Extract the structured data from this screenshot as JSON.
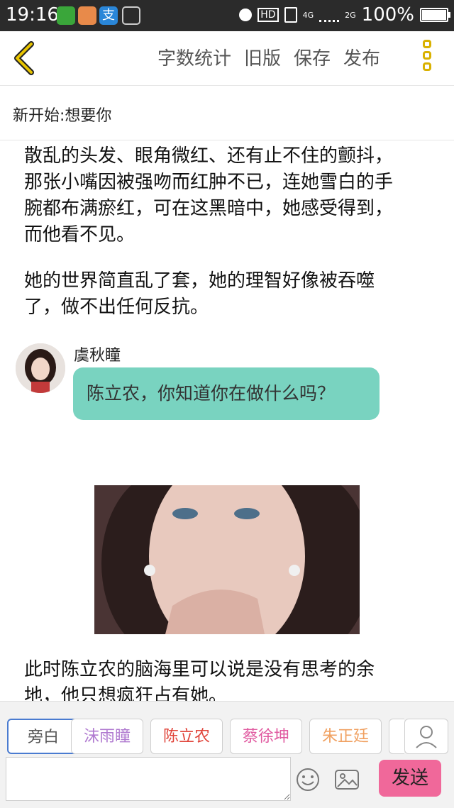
{
  "status_bar": {
    "time": "19:16",
    "network_top": "4G",
    "network_bottom": "2G",
    "hd": "HD",
    "battery": "100%",
    "battery_level": 1.0
  },
  "toolbar": {
    "word_count": "字数统计",
    "old_version": "旧版",
    "save": "保存",
    "publish": "发布"
  },
  "story_title": "新开始:想要你",
  "paragraphs": [
    "散乱的头发、眼角微红、还有止不住的颤抖，\n那张小嘴因被强吻而红肿不已，连她雪白的手\n腕都布满瘀红，可在这黑暗中，她感受得到，\n而他看不见。",
    "她的世界简直乱了套，她的理智好像被吞噬\n了，做不出任何反抗。",
    "此时陈立农的脑海里可以说是没有思考的余\n地，他只想疯狂占有她。"
  ],
  "chat_message": {
    "speaker": "虞秋瞳",
    "text": "陈立农，你知道你在做什么吗？"
  },
  "roles": [
    "旁白",
    "沫雨瞳",
    "陈立农",
    "蔡徐坤",
    "朱正廷"
  ],
  "role_colors": [
    "#555555",
    "#b07ad0",
    "#e0443a",
    "#e05aa0",
    "#f0a060"
  ],
  "colors": {
    "accent": "#d9b100",
    "bubble": "#79d3c0",
    "send": "#f0689a",
    "selected_border": "#4a7bd0"
  },
  "composer": {
    "input_value": "",
    "send": "发送"
  }
}
